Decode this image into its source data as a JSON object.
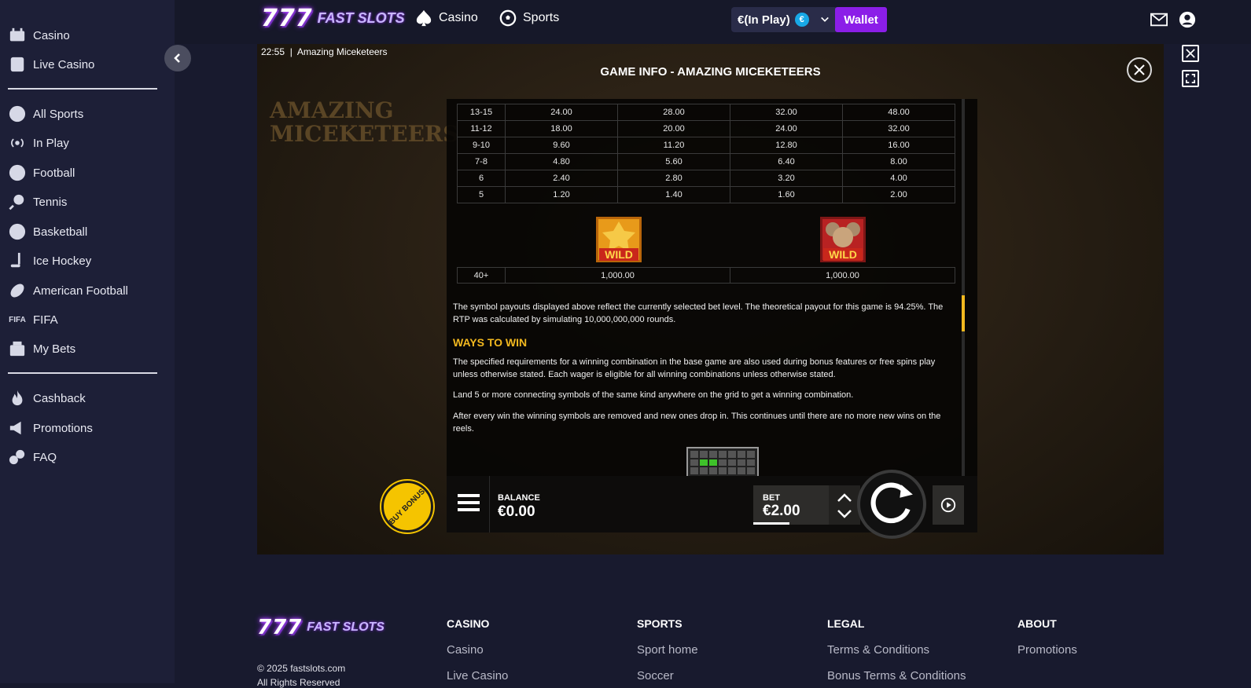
{
  "sidebar": {
    "items": [
      {
        "label": "Casino",
        "icon": "casino-icon"
      },
      {
        "label": "Live Casino",
        "icon": "live-casino-icon"
      },
      {
        "label": "All Sports",
        "icon": "star-icon"
      },
      {
        "label": "In Play",
        "icon": "broadcast-icon"
      },
      {
        "label": "Football",
        "icon": "football-icon"
      },
      {
        "label": "Tennis",
        "icon": "tennis-icon"
      },
      {
        "label": "Basketball",
        "icon": "basketball-icon"
      },
      {
        "label": "Ice Hockey",
        "icon": "ice-hockey-icon"
      },
      {
        "label": "American Football",
        "icon": "american-football-icon"
      },
      {
        "label": "FIFA",
        "icon": "fifa-icon"
      },
      {
        "label": "My Bets",
        "icon": "my-bets-icon"
      },
      {
        "label": "Cashback",
        "icon": "flame-icon"
      },
      {
        "label": "Promotions",
        "icon": "megaphone-icon"
      },
      {
        "label": "FAQ",
        "icon": "faq-icon"
      }
    ]
  },
  "header": {
    "logo_nums": "777",
    "logo_brand": "FAST SLOTS",
    "nav": [
      {
        "label": "Casino",
        "icon": "spade-icon"
      },
      {
        "label": "Sports",
        "icon": "soccer-ball-icon"
      }
    ],
    "balance_label": "€(In Play)",
    "currency_badge": "€",
    "wallet_label": "Wallet"
  },
  "game": {
    "clock": "22:55",
    "name": "Amazing Miceketeers",
    "bg_title_1": "AMAZING",
    "bg_title_2": "MICEKETEERS",
    "info_title": "GAME INFO - AMAZING MICEKETEERS",
    "pay_rows": [
      [
        "13-15",
        "24.00",
        "28.00",
        "32.00",
        "48.00"
      ],
      [
        "11-12",
        "18.00",
        "20.00",
        "24.00",
        "32.00"
      ],
      [
        "9-10",
        "9.60",
        "11.20",
        "12.80",
        "16.00"
      ],
      [
        "7-8",
        "4.80",
        "5.60",
        "6.40",
        "8.00"
      ],
      [
        "6",
        "2.40",
        "2.80",
        "3.20",
        "4.00"
      ],
      [
        "5",
        "1.20",
        "1.40",
        "1.60",
        "2.00"
      ]
    ],
    "wild_label": "WILD",
    "wild_row": [
      "40+",
      "1,000.00",
      "1,000.00"
    ],
    "para_payout": "The symbol payouts displayed above reflect the currently selected bet level. The theoretical payout for this game is 94.25%. The RTP was calculated by simulating 10,000,000,000 rounds.",
    "ways_heading": "WAYS TO WIN",
    "para_ways_1": "The specified requirements for a winning combination in the base game are also used during bonus features or free spins play unless otherwise stated. Each wager is eligible for all winning combinations unless otherwise stated.",
    "para_ways_2": "Land 5 or more connecting symbols of the same kind anywhere on the grid to get a winning combination.",
    "para_ways_3": "After every win the winning symbols are removed and new ones drop in. This continues until there are no more new wins on the reels.",
    "balance_label": "BALANCE",
    "balance_value": "€0.00",
    "bet_label": "BET",
    "bet_value": "€2.00",
    "buy_bonus": "BUY BONUS"
  },
  "footer": {
    "logo_nums": "777",
    "logo_brand": "FAST SLOTS",
    "copyright": "© 2025 fastslots.com",
    "rights": "All Rights Reserved",
    "columns": [
      {
        "heading": "CASINO",
        "links": [
          "Casino",
          "Live Casino"
        ]
      },
      {
        "heading": "SPORTS",
        "links": [
          "Sport home",
          "Soccer"
        ]
      },
      {
        "heading": "LEGAL",
        "links": [
          "Terms & Conditions",
          "Bonus Terms & Conditions"
        ]
      },
      {
        "heading": "ABOUT",
        "links": [
          "Promotions"
        ]
      }
    ]
  },
  "colors": {
    "accent": "#8b1ee8",
    "highlight": "#f2b81f",
    "sidebar": "#1d1f37",
    "page": "#181a2e"
  }
}
